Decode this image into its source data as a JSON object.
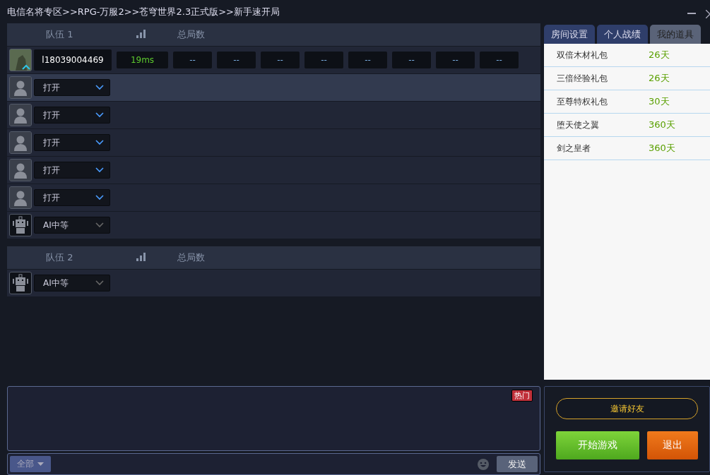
{
  "window": {
    "title": "电信名将专区>>RPG-万服2>>苍穹世界2.3正式版>>新手速开局"
  },
  "teams": [
    {
      "name": "队伍 1",
      "games_header": "总局数",
      "slots": [
        {
          "kind": "player",
          "name": "l18039004469",
          "ping": "19ms",
          "stats": [
            "--",
            "--",
            "--",
            "--",
            "--",
            "--",
            "--",
            "--"
          ],
          "highlighted": false
        },
        {
          "kind": "open",
          "choice": "打开",
          "highlighted": true
        },
        {
          "kind": "open",
          "choice": "打开",
          "highlighted": false
        },
        {
          "kind": "open",
          "choice": "打开",
          "highlighted": false
        },
        {
          "kind": "open",
          "choice": "打开",
          "highlighted": false
        },
        {
          "kind": "open",
          "choice": "打开",
          "highlighted": false
        },
        {
          "kind": "ai",
          "choice": "AI中等",
          "highlighted": false
        }
      ]
    },
    {
      "name": "队伍 2",
      "games_header": "总局数",
      "slots": [
        {
          "kind": "ai",
          "choice": "AI中等",
          "highlighted": false
        }
      ]
    }
  ],
  "tabs": [
    {
      "label": "房间设置",
      "selected": false
    },
    {
      "label": "个人战绩",
      "selected": false
    },
    {
      "label": "我的道具",
      "selected": true
    }
  ],
  "items": [
    {
      "name": "双倍木材礼包",
      "duration": "26天"
    },
    {
      "name": "三倍经验礼包",
      "duration": "26天"
    },
    {
      "name": "至尊特权礼包",
      "duration": "30天"
    },
    {
      "name": "堕天使之翼",
      "duration": "360天"
    },
    {
      "name": "剑之皇者",
      "duration": "360天"
    }
  ],
  "chat": {
    "hot_badge": "热门",
    "channel": "全部",
    "send": "发送"
  },
  "actions": {
    "invite": "邀请好友",
    "start": "开始游戏",
    "quit": "退出"
  }
}
